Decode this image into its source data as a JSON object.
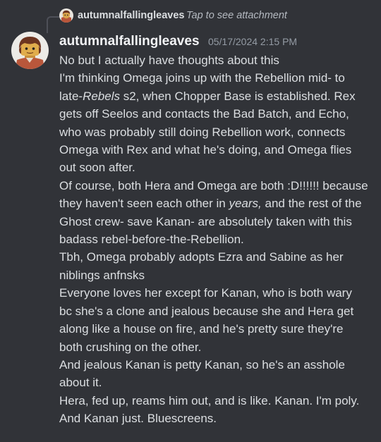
{
  "reply": {
    "username": "autumnalfallingleaves",
    "preview": "Tap to see attachment"
  },
  "message": {
    "username": "autumnalfallingleaves",
    "timestamp": "05/17/2024 2:15 PM",
    "lines": [
      [
        {
          "t": "No but I actually have thoughts about this",
          "i": false
        }
      ],
      [
        {
          "t": "I'm thinking Omega joins up with the Rebellion mid- to",
          "i": false
        }
      ],
      [
        {
          "t": "late-",
          "i": false
        },
        {
          "t": "Rebels",
          "i": true
        },
        {
          "t": " s2, when Chopper Base is established. Rex",
          "i": false
        }
      ],
      [
        {
          "t": "gets off Seelos and contacts the Bad Batch, and Echo,",
          "i": false
        }
      ],
      [
        {
          "t": "who was probably still doing Rebellion work, connects",
          "i": false
        }
      ],
      [
        {
          "t": "Omega with Rex and what he's doing, and Omega flies",
          "i": false
        }
      ],
      [
        {
          "t": "out soon after.",
          "i": false
        }
      ],
      [
        {
          "t": "Of course, both Hera and Omega are both :D!!!!!! because",
          "i": false
        }
      ],
      [
        {
          "t": "they haven't seen each other in ",
          "i": false
        },
        {
          "t": "years,",
          "i": true
        },
        {
          "t": " and the rest of the",
          "i": false
        }
      ],
      [
        {
          "t": "Ghost crew- save Kanan- are absolutely taken with this",
          "i": false
        }
      ],
      [
        {
          "t": "badass rebel-before-the-Rebellion.",
          "i": false
        }
      ],
      [
        {
          "t": "Tbh, Omega probably adopts Ezra and Sabine as her",
          "i": false
        }
      ],
      [
        {
          "t": "niblings anfnsks",
          "i": false
        }
      ],
      [
        {
          "t": "Everyone loves her except for Kanan, who is both wary",
          "i": false
        }
      ],
      [
        {
          "t": "bc she's a clone and jealous because she and Hera get",
          "i": false
        }
      ],
      [
        {
          "t": "along like a house on fire, and he's pretty sure they're",
          "i": false
        }
      ],
      [
        {
          "t": "both crushing on the other.",
          "i": false
        }
      ],
      [
        {
          "t": "And jealous Kanan is petty Kanan, so he's an asshole",
          "i": false
        }
      ],
      [
        {
          "t": "about it.",
          "i": false
        }
      ],
      [
        {
          "t": "Hera, fed up, reams him out, and is like. Kanan. I'm poly.",
          "i": false
        }
      ],
      [
        {
          "t": "And Kanan just. Bluescreens.",
          "i": false
        }
      ]
    ]
  },
  "colors": {
    "background": "#313338",
    "username": "#f2f3f5",
    "text": "#dbdee1",
    "muted": "#949ba4",
    "reply_line": "#4e5058"
  },
  "icons": {
    "reply_avatar": "lego-minifigure-avatar-icon",
    "avatar": "lego-minifigure-avatar-icon"
  }
}
